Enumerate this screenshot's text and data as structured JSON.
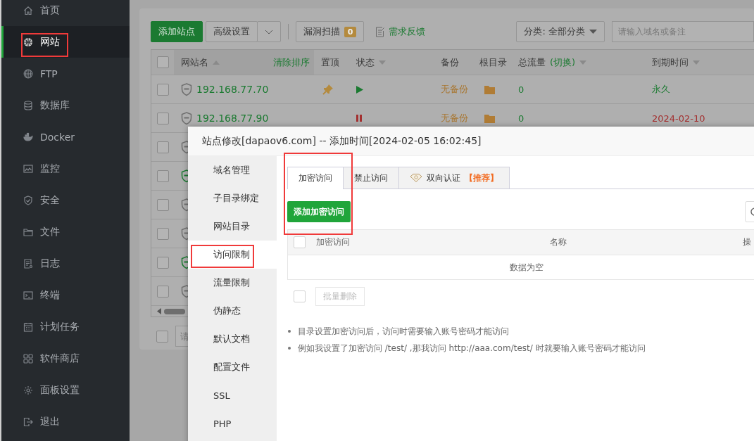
{
  "sidebar": {
    "items": [
      {
        "label": "首页",
        "selected": false
      },
      {
        "label": "网站",
        "selected": true
      },
      {
        "label": "FTP",
        "selected": false
      },
      {
        "label": "数据库",
        "selected": false
      },
      {
        "label": "Docker",
        "selected": false
      },
      {
        "label": "监控",
        "selected": false
      },
      {
        "label": "安全",
        "selected": false
      },
      {
        "label": "文件",
        "selected": false
      },
      {
        "label": "日志",
        "selected": false
      },
      {
        "label": "终端",
        "selected": false
      },
      {
        "label": "计划任务",
        "selected": false
      },
      {
        "label": "软件商店",
        "selected": false
      },
      {
        "label": "面板设置",
        "selected": false
      },
      {
        "label": "退出",
        "selected": false
      }
    ]
  },
  "toolbar": {
    "add_button": "添加站点",
    "advanced_button": "高级设置",
    "scan_button": {
      "label": "漏洞扫描",
      "count": "0"
    },
    "feedback_link": "需求反馈",
    "category_select": "分类: 全部分类",
    "search": {
      "placeholder": "请输入域名或备注"
    }
  },
  "site_table": {
    "clear_sort": "清除排序",
    "all_checked": false,
    "columns": [
      {
        "label": "网站名",
        "sort_ascending": true
      },
      {
        "label": "置顶"
      },
      {
        "label": "状态",
        "sort_ascending": false
      },
      {
        "label": "备份"
      },
      {
        "label": "根目录"
      },
      {
        "label": "总流量",
        "toggle": "(切换)",
        "sort_ascending": false
      },
      {
        "label": "到期时间",
        "sort_ascending": false
      }
    ],
    "rows": [
      {
        "checked": false,
        "waf_on": false,
        "name": "192.168.77.70",
        "pinned": true,
        "running": true,
        "backup": "无备份",
        "traffic": "0",
        "expiry": "永久",
        "expired": false
      },
      {
        "checked": false,
        "waf_on": false,
        "name": "192.168.77.90",
        "pinned": false,
        "running": false,
        "backup": "无备份",
        "traffic": "0",
        "expiry": "2024-02-10",
        "expired": true
      },
      {
        "checked": false,
        "waf_on": false
      },
      {
        "checked": false,
        "waf_on": true
      },
      {
        "checked": false,
        "waf_on": false
      },
      {
        "checked": false,
        "waf_on": false
      },
      {
        "checked": false,
        "waf_on": true
      },
      {
        "checked": false,
        "waf_on": false
      }
    ],
    "pager": {
      "checked": false,
      "placeholder": "请"
    }
  },
  "dialog": {
    "title": "站点修改[dapaov6.com] -- 添加时间[2024-02-05 16:02:45]",
    "nav": [
      {
        "label": "域名管理",
        "selected": false
      },
      {
        "label": "子目录绑定",
        "selected": false
      },
      {
        "label": "网站目录",
        "selected": false
      },
      {
        "label": "访问限制",
        "selected": true
      },
      {
        "label": "流量限制",
        "selected": false
      },
      {
        "label": "伪静态",
        "selected": false
      },
      {
        "label": "默认文档",
        "selected": false
      },
      {
        "label": "配置文件",
        "selected": false
      },
      {
        "label": "SSL",
        "selected": false
      },
      {
        "label": "PHP",
        "selected": false
      }
    ],
    "tabs": [
      {
        "label": "加密访问",
        "selected": true,
        "kind": "plain"
      },
      {
        "label": "禁止访问",
        "selected": false,
        "kind": "plain"
      },
      {
        "label": "双向认证",
        "badge": "【推荐】",
        "selected": false,
        "kind": "premium"
      }
    ],
    "add_button": "添加加密访问",
    "table": {
      "all_checked": false,
      "columns": [
        "加密访问",
        "名称",
        "操"
      ],
      "empty": "数据为空"
    },
    "batch_delete": {
      "checked": false,
      "label": "批量删除",
      "disabled": true
    },
    "tips": [
      "目录设置加密访问后，访问时需要输入账号密码才能访问",
      "例如我设置了加密访问 /test/ ,那我访问 http://aaa.com/test/ 时就要输入账号密码才能访问"
    ]
  }
}
